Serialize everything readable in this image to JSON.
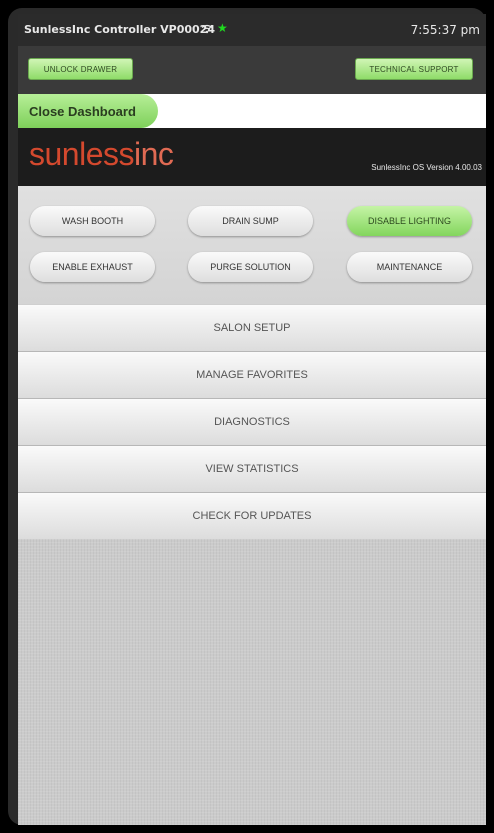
{
  "status_bar": {
    "title": "SunlessInc Controller   VP00024",
    "time": "7:55:37 pm",
    "icons": [
      "wifi-icon",
      "star-icon"
    ],
    "star_color": "#1fd81f"
  },
  "top_bar": {
    "unlock_label": "UNLOCK DRAWER",
    "tech_label": "TECHNICAL SUPPORT"
  },
  "dashboard": {
    "close_label": "Close Dashboard"
  },
  "brand": {
    "logo_sunless": "sunless",
    "logo_inc": "inc",
    "os_version": "SunlessInc OS Version 4.00.03",
    "logo_color": "#d4492e"
  },
  "controls": {
    "row1": [
      "WASH BOOTH",
      "DRAIN SUMP",
      "DISABLE LIGHTING"
    ],
    "row2": [
      "ENABLE EXHAUST",
      "PURGE SOLUTION",
      "MAINTENANCE"
    ],
    "active": "DISABLE LIGHTING",
    "active_color": "#8fdc69"
  },
  "menu": {
    "items": [
      "SALON SETUP",
      "MANAGE FAVORITES",
      "DIAGNOSTICS",
      "VIEW STATISTICS",
      "CHECK FOR UPDATES"
    ]
  }
}
